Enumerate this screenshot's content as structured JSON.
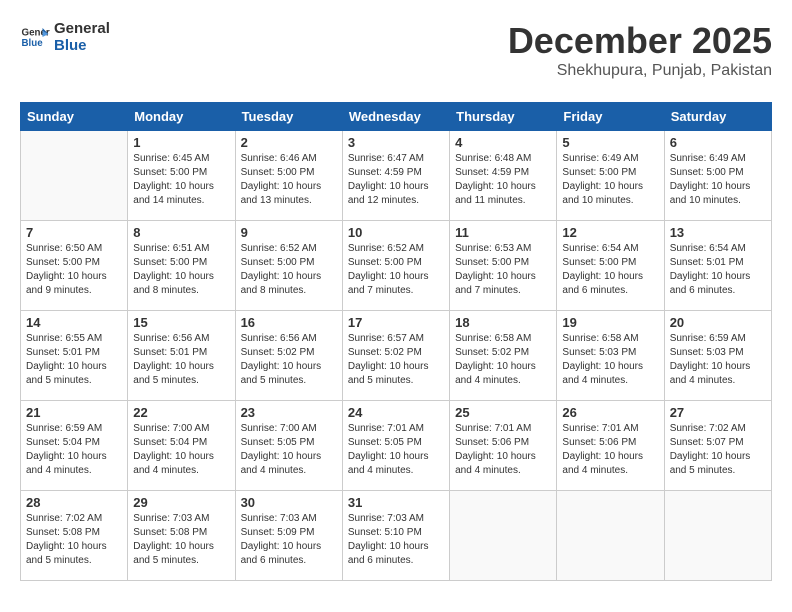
{
  "logo": {
    "line1": "General",
    "line2": "Blue"
  },
  "title": "December 2025",
  "location": "Shekhupura, Punjab, Pakistan",
  "days_of_week": [
    "Sunday",
    "Monday",
    "Tuesday",
    "Wednesday",
    "Thursday",
    "Friday",
    "Saturday"
  ],
  "weeks": [
    [
      {
        "day": "",
        "info": ""
      },
      {
        "day": "1",
        "info": "Sunrise: 6:45 AM\nSunset: 5:00 PM\nDaylight: 10 hours\nand 14 minutes."
      },
      {
        "day": "2",
        "info": "Sunrise: 6:46 AM\nSunset: 5:00 PM\nDaylight: 10 hours\nand 13 minutes."
      },
      {
        "day": "3",
        "info": "Sunrise: 6:47 AM\nSunset: 4:59 PM\nDaylight: 10 hours\nand 12 minutes."
      },
      {
        "day": "4",
        "info": "Sunrise: 6:48 AM\nSunset: 4:59 PM\nDaylight: 10 hours\nand 11 minutes."
      },
      {
        "day": "5",
        "info": "Sunrise: 6:49 AM\nSunset: 5:00 PM\nDaylight: 10 hours\nand 10 minutes."
      },
      {
        "day": "6",
        "info": "Sunrise: 6:49 AM\nSunset: 5:00 PM\nDaylight: 10 hours\nand 10 minutes."
      }
    ],
    [
      {
        "day": "7",
        "info": "Sunrise: 6:50 AM\nSunset: 5:00 PM\nDaylight: 10 hours\nand 9 minutes."
      },
      {
        "day": "8",
        "info": "Sunrise: 6:51 AM\nSunset: 5:00 PM\nDaylight: 10 hours\nand 8 minutes."
      },
      {
        "day": "9",
        "info": "Sunrise: 6:52 AM\nSunset: 5:00 PM\nDaylight: 10 hours\nand 8 minutes."
      },
      {
        "day": "10",
        "info": "Sunrise: 6:52 AM\nSunset: 5:00 PM\nDaylight: 10 hours\nand 7 minutes."
      },
      {
        "day": "11",
        "info": "Sunrise: 6:53 AM\nSunset: 5:00 PM\nDaylight: 10 hours\nand 7 minutes."
      },
      {
        "day": "12",
        "info": "Sunrise: 6:54 AM\nSunset: 5:00 PM\nDaylight: 10 hours\nand 6 minutes."
      },
      {
        "day": "13",
        "info": "Sunrise: 6:54 AM\nSunset: 5:01 PM\nDaylight: 10 hours\nand 6 minutes."
      }
    ],
    [
      {
        "day": "14",
        "info": "Sunrise: 6:55 AM\nSunset: 5:01 PM\nDaylight: 10 hours\nand 5 minutes."
      },
      {
        "day": "15",
        "info": "Sunrise: 6:56 AM\nSunset: 5:01 PM\nDaylight: 10 hours\nand 5 minutes."
      },
      {
        "day": "16",
        "info": "Sunrise: 6:56 AM\nSunset: 5:02 PM\nDaylight: 10 hours\nand 5 minutes."
      },
      {
        "day": "17",
        "info": "Sunrise: 6:57 AM\nSunset: 5:02 PM\nDaylight: 10 hours\nand 5 minutes."
      },
      {
        "day": "18",
        "info": "Sunrise: 6:58 AM\nSunset: 5:02 PM\nDaylight: 10 hours\nand 4 minutes."
      },
      {
        "day": "19",
        "info": "Sunrise: 6:58 AM\nSunset: 5:03 PM\nDaylight: 10 hours\nand 4 minutes."
      },
      {
        "day": "20",
        "info": "Sunrise: 6:59 AM\nSunset: 5:03 PM\nDaylight: 10 hours\nand 4 minutes."
      }
    ],
    [
      {
        "day": "21",
        "info": "Sunrise: 6:59 AM\nSunset: 5:04 PM\nDaylight: 10 hours\nand 4 minutes."
      },
      {
        "day": "22",
        "info": "Sunrise: 7:00 AM\nSunset: 5:04 PM\nDaylight: 10 hours\nand 4 minutes."
      },
      {
        "day": "23",
        "info": "Sunrise: 7:00 AM\nSunset: 5:05 PM\nDaylight: 10 hours\nand 4 minutes."
      },
      {
        "day": "24",
        "info": "Sunrise: 7:01 AM\nSunset: 5:05 PM\nDaylight: 10 hours\nand 4 minutes."
      },
      {
        "day": "25",
        "info": "Sunrise: 7:01 AM\nSunset: 5:06 PM\nDaylight: 10 hours\nand 4 minutes."
      },
      {
        "day": "26",
        "info": "Sunrise: 7:01 AM\nSunset: 5:06 PM\nDaylight: 10 hours\nand 4 minutes."
      },
      {
        "day": "27",
        "info": "Sunrise: 7:02 AM\nSunset: 5:07 PM\nDaylight: 10 hours\nand 5 minutes."
      }
    ],
    [
      {
        "day": "28",
        "info": "Sunrise: 7:02 AM\nSunset: 5:08 PM\nDaylight: 10 hours\nand 5 minutes."
      },
      {
        "day": "29",
        "info": "Sunrise: 7:03 AM\nSunset: 5:08 PM\nDaylight: 10 hours\nand 5 minutes."
      },
      {
        "day": "30",
        "info": "Sunrise: 7:03 AM\nSunset: 5:09 PM\nDaylight: 10 hours\nand 6 minutes."
      },
      {
        "day": "31",
        "info": "Sunrise: 7:03 AM\nSunset: 5:10 PM\nDaylight: 10 hours\nand 6 minutes."
      },
      {
        "day": "",
        "info": ""
      },
      {
        "day": "",
        "info": ""
      },
      {
        "day": "",
        "info": ""
      }
    ]
  ]
}
